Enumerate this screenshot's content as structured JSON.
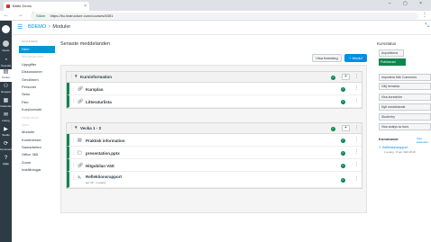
{
  "browser": {
    "tab_title": "Bätte Demo",
    "tab_close": "×",
    "window_controls": "– ▢ ×",
    "nav_buttons": "← → ↻",
    "security_label": "Säker",
    "url": "https://ltu.instructure.com/courses/6351",
    "menu": "⋮"
  },
  "global_nav": {
    "items": [
      {
        "label": "Konto",
        "icon": "user-icon"
      },
      {
        "label": "Översikt",
        "icon": "dashboard-icon"
      },
      {
        "label": "Kurser",
        "icon": "book-icon"
      },
      {
        "label": "Grupper",
        "icon": "groups-icon"
      },
      {
        "label": "Kalender",
        "icon": "calendar-icon"
      },
      {
        "label": "Inkorg",
        "icon": "inbox-icon"
      },
      {
        "label": "Studio",
        "icon": "studio-icon"
      },
      {
        "label": "Commons",
        "icon": "commons-icon"
      },
      {
        "label": "Hjälp",
        "icon": "help-icon"
      }
    ]
  },
  "header": {
    "course": "BDEMO",
    "separator": ">",
    "page": "Moduler"
  },
  "course_nav": {
    "term": "HUVUDSIDA",
    "items": [
      {
        "label": "Hem",
        "state": "active"
      },
      {
        "label": "Meddelanden",
        "state": "disabled"
      },
      {
        "label": "Uppgifter",
        "state": "normal"
      },
      {
        "label": "Diskussioner",
        "state": "normal"
      },
      {
        "label": "Omdömen",
        "state": "normal"
      },
      {
        "label": "Personer",
        "state": "normal"
      },
      {
        "label": "Sidor",
        "state": "normal"
      },
      {
        "label": "Filer",
        "state": "normal"
      },
      {
        "label": "Kursöversikt",
        "state": "normal"
      },
      {
        "label": "Utvärderat",
        "state": "disabled"
      },
      {
        "label": "Quiz",
        "state": "disabled"
      },
      {
        "label": "Moduler",
        "state": "normal"
      },
      {
        "label": "Konferenser",
        "state": "normal"
      },
      {
        "label": "Samarbeten",
        "state": "normal"
      },
      {
        "label": "Office 365",
        "state": "normal"
      },
      {
        "label": "Zoom",
        "state": "normal"
      },
      {
        "label": "Inställningar",
        "state": "normal"
      }
    ]
  },
  "main": {
    "title": "Senaste meddelanden",
    "view_progress": "Visa framsteg",
    "add_module": "+ Modul",
    "modules": [
      {
        "name": "Kursinformation",
        "items": [
          {
            "title": "Kursplan",
            "icon": "link-icon",
            "sub": ""
          },
          {
            "title": "Litteraturlista",
            "icon": "link-icon",
            "sub": ""
          }
        ]
      },
      {
        "name": "Vecka 1 - 3",
        "items": [
          {
            "title": "Praktisk information",
            "icon": "page-icon",
            "sub": ""
          },
          {
            "title": "presentation.pptx",
            "icon": "attachment-icon",
            "sub": ""
          },
          {
            "title": "Hitgobilan Vätt",
            "icon": "link-icon",
            "sub": ""
          },
          {
            "title": "Reflektionsrapport",
            "icon": "assignment-icon",
            "sub": "apr 30 · 1 poäng"
          }
        ]
      }
    ],
    "published_glyph": "✓",
    "add_glyph": "+",
    "kebab_glyph": "⋮",
    "drag_glyph": "⋮⋮",
    "caret_glyph": "▾"
  },
  "sidebar": {
    "status_title": "Kursstatus",
    "unpublish": "Avpublicera",
    "published": "Publicerad",
    "buttons": [
      "Importera från Commons",
      "Välj hemsida",
      "Visa kursström",
      "Nytt meddelande",
      "Studiertry",
      "Visa analys av kurs"
    ],
    "upcoming_title": "Kommande",
    "upcoming_link": "Visa kalendern",
    "upcoming_item": "Reflektionsrapport",
    "upcoming_meta": "1 poäng · 8 apr 30/4 2019"
  },
  "colors": {
    "accent": "#008ee2",
    "published": "#0b874b",
    "nav_bg": "#2d3b45"
  }
}
